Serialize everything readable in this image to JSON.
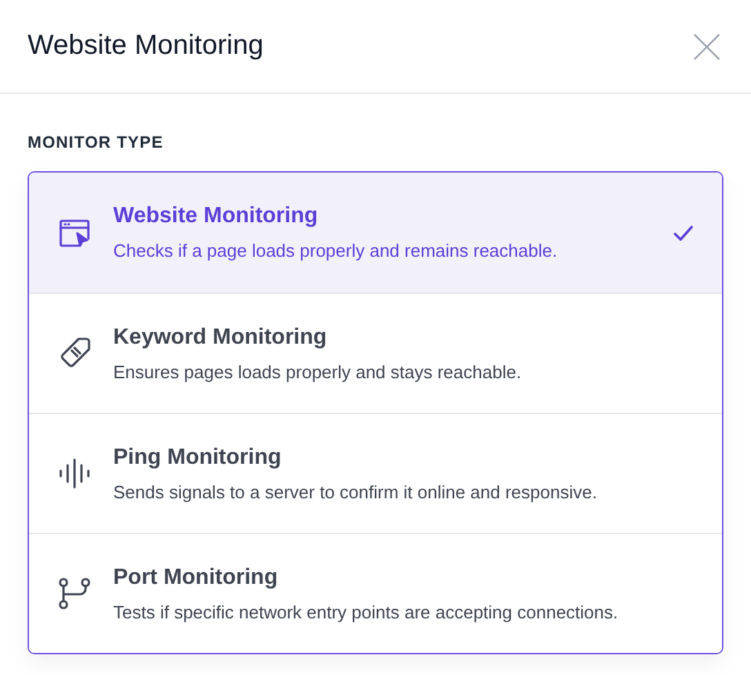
{
  "dialog": {
    "title": "Website Monitoring"
  },
  "section_label": "MONITOR TYPE",
  "options": [
    {
      "kind": "website",
      "title": "Website Monitoring",
      "description": "Checks if a page loads properly and remains reachable.",
      "selected": true
    },
    {
      "kind": "keyword",
      "title": "Keyword Monitoring",
      "description": "Ensures pages loads properly and stays reachable.",
      "selected": false
    },
    {
      "kind": "ping",
      "title": "Ping Monitoring",
      "description": "Sends signals to a server to confirm it online and responsive.",
      "selected": false
    },
    {
      "kind": "port",
      "title": "Port Monitoring",
      "description": "Tests if specific network entry points are accepting connections.",
      "selected": false
    }
  ]
}
